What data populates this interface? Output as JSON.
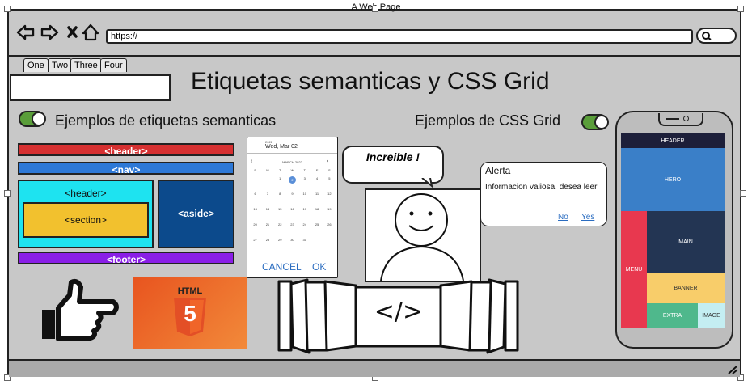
{
  "window": {
    "title": "A Web Page",
    "url": "https://"
  },
  "tabs": [
    "One",
    "Two",
    "Three",
    "Four"
  ],
  "heading": "Etiquetas semanticas y CSS Grid",
  "left_toggle_label": "Ejemplos de etiquetas semanticas",
  "right_toggle_label": "Ejemplos de CSS Grid",
  "semantic": {
    "header_top": "<header>",
    "nav": "<nav>",
    "header_inner": "<header>",
    "section": "<section>",
    "aside": "<aside>",
    "footer": "<footer>"
  },
  "calendar": {
    "year": "2022",
    "date": "Wed, Mar 02",
    "month": "MARCH 2022",
    "weekdays": [
      "S",
      "M",
      "T",
      "W",
      "T",
      "F",
      "S"
    ],
    "weeks": [
      [
        "",
        "",
        "1",
        "2",
        "3",
        "4",
        "5"
      ],
      [
        "6",
        "7",
        "8",
        "9",
        "10",
        "11",
        "12"
      ],
      [
        "13",
        "14",
        "15",
        "16",
        "17",
        "18",
        "19"
      ],
      [
        "20",
        "21",
        "22",
        "23",
        "24",
        "25",
        "26"
      ],
      [
        "27",
        "28",
        "29",
        "30",
        "31",
        "",
        ""
      ]
    ],
    "selected": "2",
    "cancel": "CANCEL",
    "ok": "OK"
  },
  "bubble_text": "Increible !",
  "alert": {
    "title": "Alerta",
    "message": "Informacion valiosa, desea leer",
    "no": "No",
    "yes": "Yes"
  },
  "html5_logo_text": "HTML",
  "html5_number": "5",
  "code_symbol": "</>",
  "phone_grid": {
    "header": "HEADER",
    "hero": "HERO",
    "menu": "MENU",
    "main": "MAIN",
    "banner": "BANNER",
    "extra": "EXTRA",
    "image": "IMAGE"
  },
  "colors": {
    "header_red": "#d63031",
    "nav_blue": "#2d78d6",
    "cyan": "#1ee3f0",
    "section_yellow": "#f2c12e",
    "aside_blue": "#0c4a8c",
    "footer_purple": "#8a1ee6",
    "toggle_green": "#5a9e3a"
  }
}
